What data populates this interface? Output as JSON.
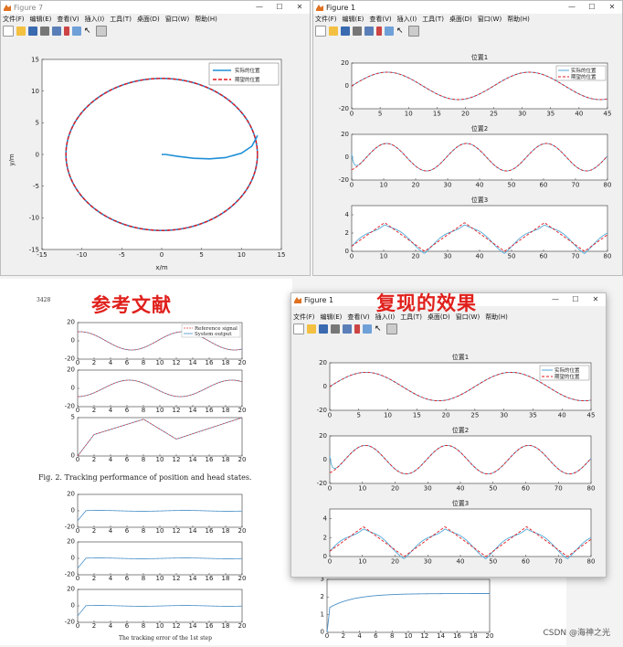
{
  "menu_items": [
    "文件(F)",
    "编辑(E)",
    "查看(V)",
    "插入(I)",
    "工具(T)",
    "桌面(D)",
    "窗口(W)",
    "帮助(H)"
  ],
  "colors": {
    "actual": "#1f8fd6",
    "desired": "#e4161b",
    "reference_red": "#e04040",
    "reference_blue": "#4a90c8"
  },
  "window_figure7": {
    "title": "Figure 7",
    "chart_data": {
      "type": "line",
      "title": "",
      "xlabel": "x/m",
      "ylabel": "y/m",
      "xlim": [
        -15,
        15
      ],
      "ylim": [
        -15,
        15
      ],
      "xticks": [
        -15,
        -10,
        -5,
        0,
        5,
        10,
        15
      ],
      "yticks": [
        -15,
        -10,
        -5,
        0,
        5,
        10,
        15
      ],
      "legend_position": "top-right",
      "series": [
        {
          "name": "实际的位置",
          "style": "solid",
          "note_shape": "circle radius 12 centered at origin, plus initial transient from (0,0)"
        },
        {
          "name": "期望的位置",
          "style": "dashed"
        }
      ]
    }
  },
  "window_figure1_top": {
    "title": "Figure 1",
    "charts": [
      {
        "type": "line",
        "title": "位置1",
        "xlim": [
          0,
          45
        ],
        "ylim": [
          -20,
          20
        ],
        "xticks": [
          0,
          5,
          10,
          15,
          20,
          25,
          30,
          35,
          40,
          45
        ],
        "yticks": [
          -20,
          0,
          20
        ],
        "amplitude": 12,
        "period": 25,
        "legend": [
          "实际的位置",
          "期望的位置"
        ],
        "legend_position": "top-right"
      },
      {
        "type": "line",
        "title": "位置2",
        "xlim": [
          0,
          80
        ],
        "ylim": [
          -20,
          20
        ],
        "xticks": [
          0,
          10,
          20,
          30,
          40,
          50,
          60,
          70,
          80
        ],
        "yticks": [
          -20,
          0,
          20
        ],
        "amplitude": 12,
        "period": 25
      },
      {
        "type": "line",
        "title": "位置3",
        "xlim": [
          0,
          80
        ],
        "ylim": [
          0,
          5
        ],
        "xticks": [
          0,
          10,
          20,
          30,
          40,
          50,
          60,
          70,
          80
        ],
        "yticks": [
          0,
          2,
          4
        ],
        "shape": "triangle wave 0 to 3.14, period 25"
      }
    ]
  },
  "paper": {
    "label_reference": "参考文献",
    "page_number": "3428",
    "fig2_caption": "Fig. 2.   Tracking performance of position and head states.",
    "fig3_caption": "The tracking error of the 1st step",
    "legend": [
      "Reference signal",
      "System output"
    ],
    "top_charts": [
      {
        "xlim": [
          0,
          20
        ],
        "ylim": [
          -20,
          20
        ],
        "yticks": [
          -20,
          0,
          20
        ],
        "xticks": [
          0,
          2,
          4,
          6,
          8,
          10,
          12,
          14,
          16,
          18,
          20
        ]
      },
      {
        "xlim": [
          0,
          20
        ],
        "ylim": [
          -20,
          20
        ],
        "yticks": [
          -20,
          0,
          20
        ],
        "xticks": [
          0,
          2,
          4,
          6,
          8,
          10,
          12,
          14,
          16,
          18,
          20
        ]
      },
      {
        "xlim": [
          0,
          20
        ],
        "ylim": [
          0,
          5
        ],
        "yticks": [
          0,
          5
        ],
        "xticks": [
          0,
          2,
          4,
          6,
          8,
          10,
          12,
          14,
          16,
          18,
          20
        ]
      }
    ],
    "bottom_charts": [
      {
        "xlim": [
          0,
          20
        ],
        "ylim": [
          -20,
          20
        ],
        "yticks": [
          -20,
          0,
          20
        ],
        "xticks": [
          0,
          2,
          4,
          6,
          8,
          10,
          12,
          14,
          16,
          18,
          20
        ]
      },
      {
        "xlim": [
          0,
          20
        ],
        "ylim": [
          -20,
          20
        ],
        "yticks": [
          -20,
          0,
          20
        ],
        "xticks": [
          0,
          2,
          4,
          6,
          8,
          10,
          12,
          14,
          16,
          18,
          20
        ]
      },
      {
        "xlim": [
          0,
          20
        ],
        "ylim": [
          -20,
          20
        ],
        "yticks": [
          -20,
          0,
          20
        ],
        "xticks": [
          0,
          2,
          4,
          6,
          8,
          10,
          12,
          14,
          16,
          18,
          20
        ]
      }
    ],
    "right_chart": {
      "xlim": [
        0,
        20
      ],
      "ylim": [
        0,
        3
      ],
      "yticks": [
        0,
        1,
        2,
        3
      ],
      "xticks": [
        0,
        2,
        4,
        6,
        8,
        10,
        12,
        14,
        16,
        18,
        20
      ]
    }
  },
  "label_reproduction": "复现的效果",
  "window_figure1_bottom": {
    "title": "Figure 1",
    "charts": [
      {
        "title": "位置1",
        "xlim": [
          0,
          45
        ],
        "ylim": [
          -20,
          20
        ],
        "xticks": [
          0,
          5,
          10,
          15,
          20,
          25,
          30,
          35,
          40,
          45
        ],
        "yticks": [
          -20,
          0,
          20
        ],
        "legend": [
          "实际的位置",
          "期望的位置"
        ]
      },
      {
        "title": "位置2",
        "xlim": [
          0,
          80
        ],
        "ylim": [
          -20,
          20
        ],
        "xticks": [
          0,
          10,
          20,
          30,
          40,
          50,
          60,
          70,
          80
        ],
        "yticks": [
          -20,
          0,
          20
        ]
      },
      {
        "title": "位置3",
        "xlim": [
          0,
          80
        ],
        "ylim": [
          0,
          5
        ],
        "xticks": [
          0,
          10,
          20,
          30,
          40,
          50,
          60,
          70,
          80
        ],
        "yticks": [
          0,
          2,
          4
        ]
      }
    ]
  },
  "watermark": "CSDN @海神之光"
}
